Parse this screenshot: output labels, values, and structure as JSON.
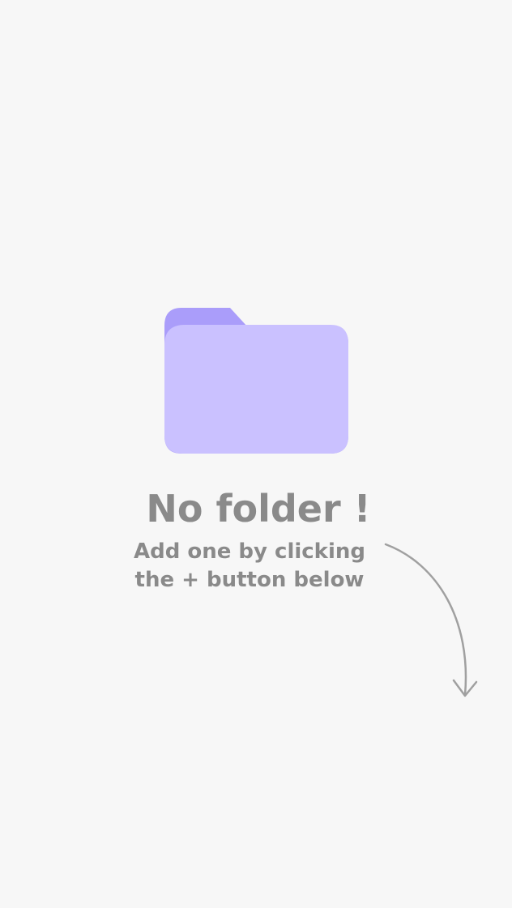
{
  "empty_state": {
    "icon": "folder-icon",
    "title": "No folder !",
    "subtitle_line1": "Add one by clicking",
    "subtitle_line2": "the + button below",
    "hint_icon": "curved-arrow-down-icon"
  },
  "colors": {
    "background": "#f7f7f7",
    "folder_front": "#cac1ff",
    "folder_back": "#aa9dfa",
    "text": "#8a8a8a",
    "arrow": "#a0a0a0"
  }
}
